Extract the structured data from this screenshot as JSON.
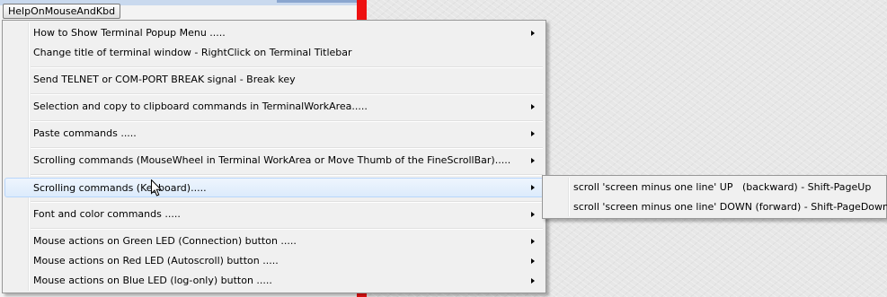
{
  "menubar": {
    "title": "HelpOnMouseAndKbd"
  },
  "colors": {
    "accent_red": "#ee1111",
    "highlight_border": "#b8d6fb",
    "menu_bg": "#f0f0f0"
  },
  "menu": {
    "items": [
      {
        "label": "How to Show Terminal Popup Menu .....",
        "submenu": true
      },
      {
        "label": "Change title of terminal window - RightClick on Terminal Titlebar",
        "submenu": false
      },
      {
        "label": "Send TELNET or COM-PORT BREAK signal - Break key",
        "submenu": false
      },
      {
        "label": "Selection and copy to clipboard commands in TerminalWorkArea.....",
        "submenu": true
      },
      {
        "label": "Paste commands .....",
        "submenu": true
      },
      {
        "label": "Scrolling commands (MouseWheel in Terminal WorkArea or Move Thumb of the FineScrollBar).....",
        "submenu": true
      },
      {
        "label": "Scrolling commands (Keyboard).....",
        "submenu": true,
        "highlighted": true
      },
      {
        "label": "Font and color commands .....",
        "submenu": true
      },
      {
        "label": "Mouse actions on Green LED (Connection) button .....",
        "submenu": true
      },
      {
        "label": "Mouse actions on Red LED (Autoscroll) button .....",
        "submenu": true
      },
      {
        "label": "Mouse actions on Blue LED (log-only) button .....",
        "submenu": true
      }
    ]
  },
  "submenu": {
    "items": [
      {
        "label": "scroll 'screen minus one line' UP   (backward) - Shift-PageUp"
      },
      {
        "label": "scroll 'screen minus one line' DOWN (forward) - Shift-PageDown"
      }
    ]
  },
  "icons": {
    "arrow": "submenu-arrow-icon",
    "cursor": "mouse-pointer-icon"
  }
}
